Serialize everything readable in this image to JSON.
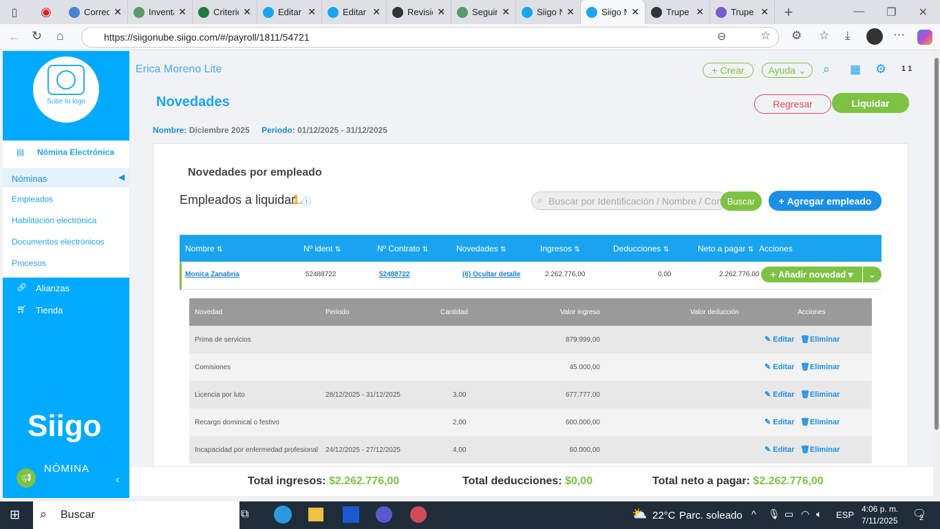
{
  "browser": {
    "tabs": [
      {
        "label": "Correo",
        "color": "#4a7fd6"
      },
      {
        "label": "Inventario",
        "color": "#5a9a6a"
      },
      {
        "label": "Criterios",
        "color": "#1e7a3c"
      },
      {
        "label": "Editar",
        "color": "#1aa4f0"
      },
      {
        "label": "Editar",
        "color": "#1aa4f0"
      },
      {
        "label": "Revisión",
        "color": "#333"
      },
      {
        "label": "Seguimiento",
        "color": "#5a9a6a"
      },
      {
        "label": "Siigo N",
        "color": "#1aa4f0"
      },
      {
        "label": "Siigo N",
        "color": "#1aa4f0",
        "active": true
      },
      {
        "label": "Trupe",
        "color": "#333"
      },
      {
        "label": "Trupe",
        "color": "#7a5ad0"
      }
    ],
    "url": "https://siigonube.siigo.com/#/payroll/1811/54721"
  },
  "sidebar": {
    "logo_text": "Sube tu logo",
    "section": "Nómina Electrónica",
    "items": [
      "Nóminas",
      "Empleados",
      "Habilitación electrónica",
      "Documentos electrónicos",
      "Procesos"
    ],
    "extra": [
      "Alianzas",
      "Tienda"
    ],
    "brand": "Siigo",
    "brand_sub": "NÓMINA"
  },
  "header": {
    "company": "Erica Moreno Lite",
    "crear": "+ Crear",
    "ayuda": "Ayuda",
    "user": "1 1"
  },
  "page": {
    "title": "Novedades",
    "regresar": "Regresar",
    "liquidar": "Liquidar",
    "nombre_label": "Nombre:",
    "nombre": "Diciembre 2025",
    "periodo_label": "Periodo:",
    "periodo": "01/12/2025 - 31/12/2025"
  },
  "card": {
    "title": "Novedades por empleado",
    "empleados_label": "Empleados a liquidar",
    "empleados_count": "1.",
    "search_placeholder": "Buscar por Identificación / Nombre / Contrato",
    "buscar": "Buscar",
    "agregar": "Agregar empleado"
  },
  "table": {
    "headers": [
      "Nombre",
      "Nº ident",
      "Nº Contrato",
      "Novedades",
      "Ingresos",
      "Deducciones",
      "Neto a pagar",
      "Acciones"
    ],
    "row": {
      "nombre": "Monica Zanabria",
      "ident": "52488722",
      "contrato": "52488722",
      "novedades": "(6) Ocultar detalle",
      "ingresos": "2.262.776,00",
      "deducciones": "0,00",
      "neto": "2.262.776,00",
      "action": "Añadir novedad"
    }
  },
  "detail": {
    "headers": [
      "Novedad",
      "Periodo",
      "Cantidad",
      "Valor ingreso",
      "Valor deducción",
      "Acciones"
    ],
    "edit": "Editar",
    "delete": "Eliminar",
    "rows": [
      {
        "novedad": "Prima de servicios",
        "periodo": "",
        "cantidad": "",
        "ingreso": "879.999,00",
        "deduccion": ""
      },
      {
        "novedad": "Comisiones",
        "periodo": "",
        "cantidad": "",
        "ingreso": "45.000,00",
        "deduccion": ""
      },
      {
        "novedad": "Licencia por luto",
        "periodo": "28/12/2025 - 31/12/2025",
        "cantidad": "3,00",
        "ingreso": "677.777,00",
        "deduccion": ""
      },
      {
        "novedad": "Recargo dominical o festivo",
        "periodo": "",
        "cantidad": "2,00",
        "ingreso": "600.000,00",
        "deduccion": ""
      },
      {
        "novedad": "Incapacidad por enfermedad profesional",
        "periodo": "24/12/2025 - 27/12/2025",
        "cantidad": "4,00",
        "ingreso": "60.000,00",
        "deduccion": ""
      }
    ]
  },
  "totals": {
    "ingresos_label": "Total ingresos:",
    "ingresos": "$2.262.776,00",
    "deducciones_label": "Total deducciones:",
    "deducciones": "$0,00",
    "neto_label": "Total neto a pagar:",
    "neto": "$2.262.776,00"
  },
  "taskbar": {
    "search": "Buscar",
    "weather": "22°C",
    "weather_desc": "Parc. soleado",
    "lang": "ESP",
    "time": "4:06 p. m.",
    "date": "7/11/2025",
    "notifications": "2"
  }
}
